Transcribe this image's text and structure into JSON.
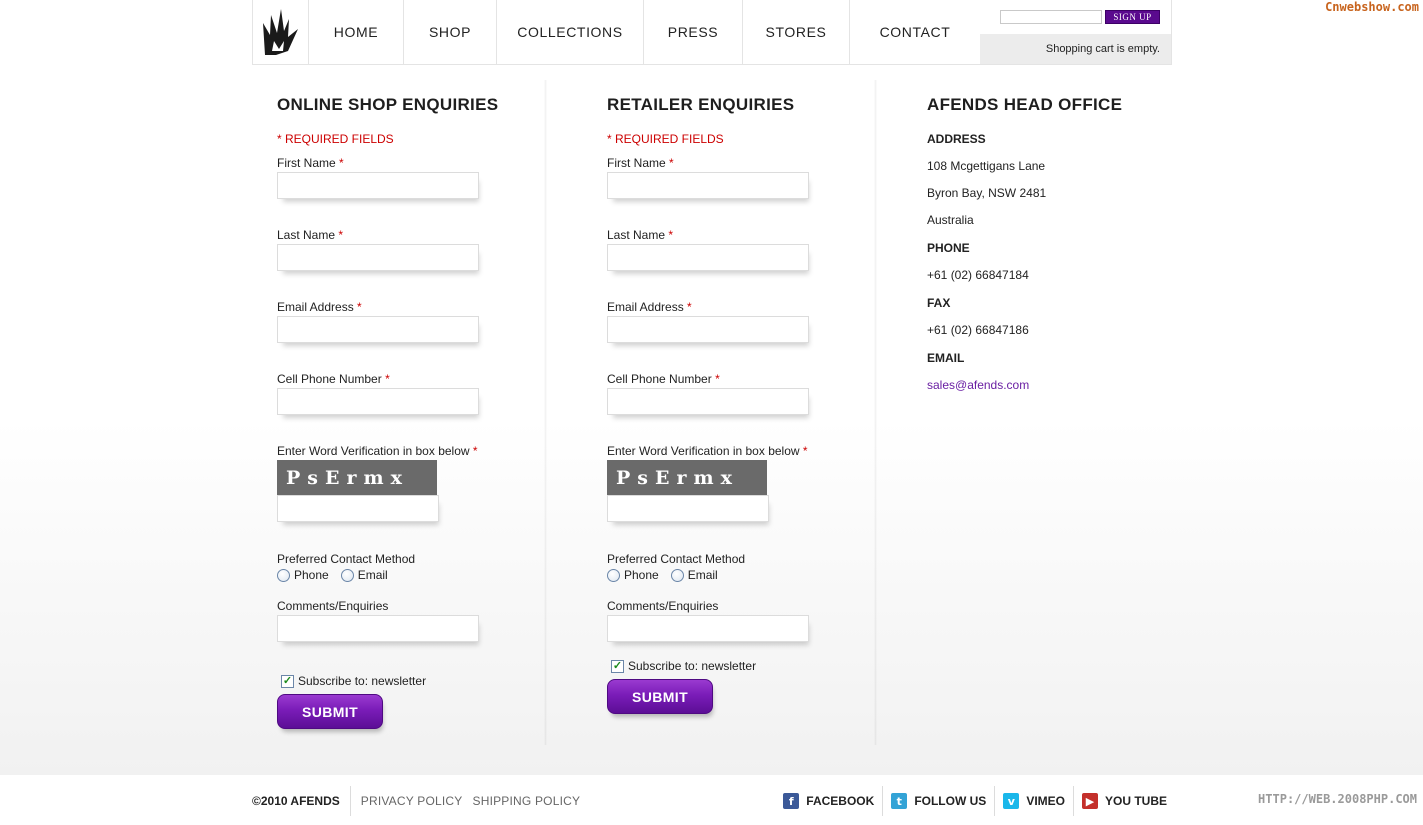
{
  "watermarks": {
    "top": "Cnwebshow.com",
    "bottom": "HTTP://WEB.2008PHP.COM"
  },
  "header": {
    "nav": [
      "HOME",
      "SHOP",
      "COLLECTIONS",
      "PRESS",
      "STORES",
      "CONTACT"
    ],
    "signup": {
      "button": "SIGN UP",
      "placeholder": ""
    },
    "cart_status": "Shopping cart is empty."
  },
  "online_form": {
    "title": "ONLINE SHOP ENQUIRIES",
    "required_note": "* REQUIRED FIELDS",
    "first_name": "First Name",
    "last_name": "Last Name",
    "email": "Email Address",
    "cell": "Cell Phone Number",
    "verification": "Enter Word Verification in box below",
    "captcha_text": "PsErmx",
    "contact_method": "Preferred Contact Method",
    "phone": "Phone",
    "email_opt": "Email",
    "comments": "Comments/Enquiries",
    "subscribe": "Subscribe to: newsletter",
    "submit": "SUBMIT",
    "required_star": "*"
  },
  "retailer_form": {
    "title": "RETAILER ENQUIRIES",
    "required_note": "* REQUIRED FIELDS",
    "first_name": "First Name",
    "last_name": "Last Name",
    "email": "Email Address",
    "cell": "Cell Phone Number",
    "verification": "Enter Word Verification in box below",
    "captcha_text": "PsErmx",
    "contact_method": "Preferred Contact Method",
    "phone": "Phone",
    "email_opt": "Email",
    "comments": "Comments/Enquiries",
    "subscribe": "Subscribe to: newsletter",
    "submit": "SUBMIT",
    "required_star": "*"
  },
  "office": {
    "title": "AFENDS HEAD OFFICE",
    "address_label": "ADDRESS",
    "address_lines": [
      "108 Mcgettigans Lane",
      "Byron Bay, NSW 2481",
      "Australia"
    ],
    "phone_label": "PHONE",
    "phone": "+61 (02) 66847184",
    "fax_label": "FAX",
    "fax": "+61 (02) 66847186",
    "email_label": "EMAIL",
    "email": "sales@afends.com"
  },
  "footer": {
    "copyright": "©2010 AFENDS",
    "privacy": "PRIVACY POLICY",
    "shipping": "SHIPPING POLICY",
    "social": [
      {
        "label": "FACEBOOK",
        "icon": "facebook-icon",
        "color": "#3b5998"
      },
      {
        "label": "FOLLOW US",
        "icon": "twitter-icon",
        "color": "#33a3d6"
      },
      {
        "label": "VIMEO",
        "icon": "vimeo-icon",
        "color": "#1ab7ea"
      },
      {
        "label": "YOU TUBE",
        "icon": "youtube-icon",
        "color": "#c4302b"
      }
    ]
  },
  "colors": {
    "accent": "#5a0a8e",
    "required": "#cc0000",
    "link": "#6a1fa3"
  }
}
